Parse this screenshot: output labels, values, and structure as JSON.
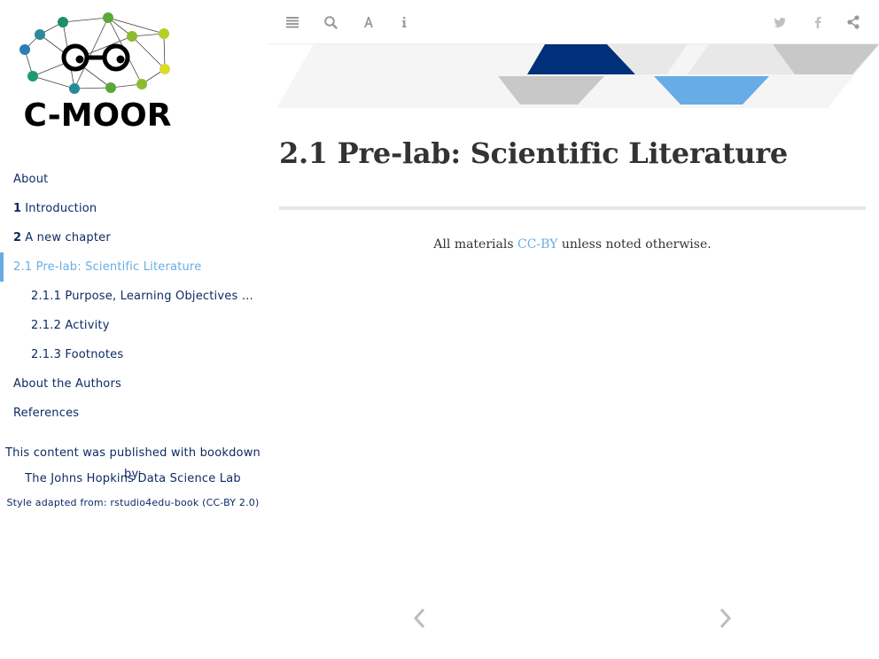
{
  "logo": {
    "text": "C-MOOR"
  },
  "toolbar": {
    "left_icons": [
      "toc-toggle-icon",
      "search-icon",
      "font-settings-icon",
      "info-icon"
    ],
    "right_icons": [
      "twitter-icon",
      "facebook-icon",
      "share-icon"
    ]
  },
  "toc": {
    "items": [
      {
        "num": "",
        "label": "About"
      },
      {
        "num": "1",
        "label": "Introduction"
      },
      {
        "num": "2",
        "label": "A new chapter"
      },
      {
        "num": "",
        "label": "2.1 Pre-lab: Scientific Literature"
      },
      {
        "num": "",
        "label": "2.1.1 Purpose, Learning Objectives and…"
      },
      {
        "num": "",
        "label": "2.1.2 Activity"
      },
      {
        "num": "",
        "label": "2.1.3 Footnotes"
      },
      {
        "num": "",
        "label": "About the Authors"
      },
      {
        "num": "",
        "label": "References"
      }
    ]
  },
  "credits": {
    "line1": "This content was published with bookdown by:",
    "line2": "The Johns Hopkins Data Science Lab",
    "line3": "Style adapted from: rstudio4edu-book (CC-BY 2.0)"
  },
  "main": {
    "title": "2.1 Pre-lab: Scientific Literature",
    "license_prefix": "All materials ",
    "license_link": "CC-BY",
    "license_suffix": " unless noted otherwise."
  },
  "colors": {
    "accent": "#68ace5",
    "navy": "#0d2b63",
    "banner_dark": "#00307a"
  }
}
